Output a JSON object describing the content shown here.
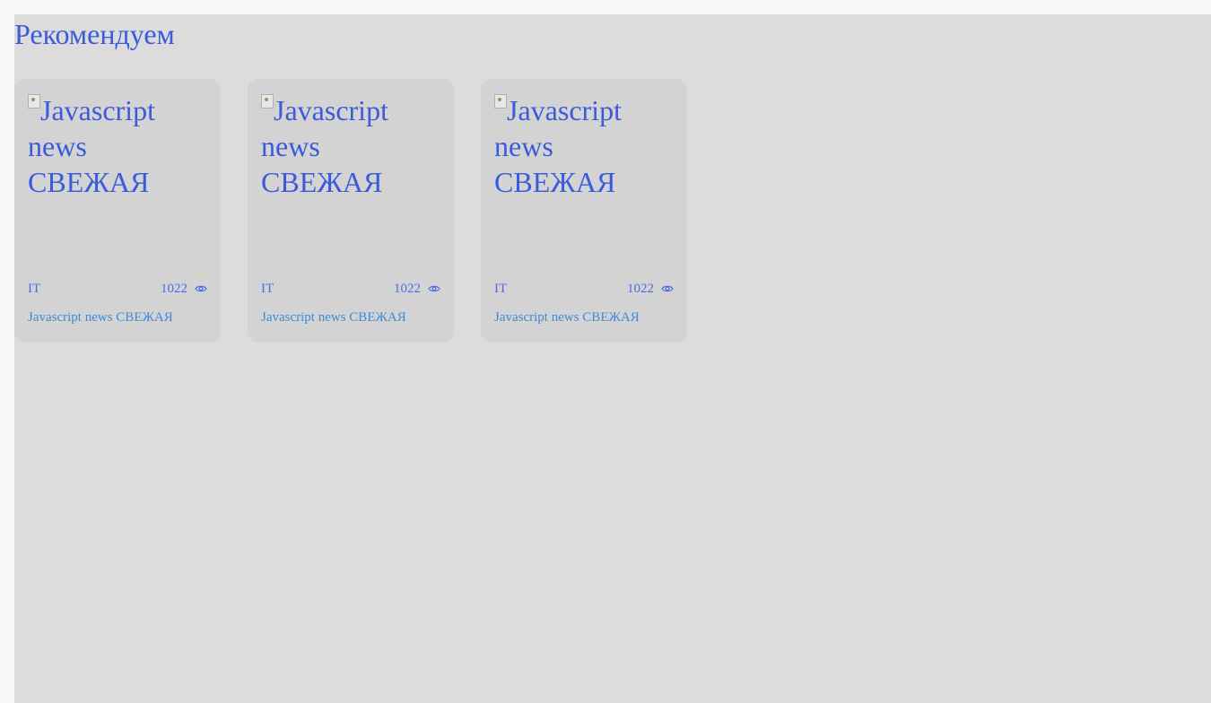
{
  "section": {
    "title": "Рекомендуем"
  },
  "cards": [
    {
      "image_alt": "Javascript news СВЕЖАЯ",
      "category": "IT",
      "views": "1022",
      "title": "Javascript news СВЕЖАЯ"
    },
    {
      "image_alt": "Javascript news СВЕЖАЯ",
      "category": "IT",
      "views": "1022",
      "title": "Javascript news СВЕЖАЯ"
    },
    {
      "image_alt": "Javascript news СВЕЖАЯ",
      "category": "IT",
      "views": "1022",
      "title": "Javascript news СВЕЖАЯ"
    }
  ],
  "colors": {
    "accent": "#3b5bdb",
    "link": "#3d8bd9",
    "card_bg": "#d3d3d3",
    "page_bg": "#dcdcdc"
  },
  "icons": {
    "views": "eye-icon",
    "image_placeholder": "broken-image-icon"
  }
}
